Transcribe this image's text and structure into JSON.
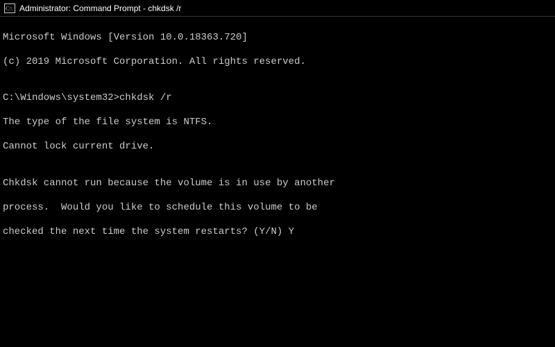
{
  "titlebar": {
    "text": "Administrator: Command Prompt - chkdsk  /r"
  },
  "terminal": {
    "line1": "Microsoft Windows [Version 10.0.18363.720]",
    "line2": "(c) 2019 Microsoft Corporation. All rights reserved.",
    "blank1": "",
    "prompt": "C:\\Windows\\system32>",
    "command": "chkdsk /r",
    "line3": "The type of the file system is NTFS.",
    "line4": "Cannot lock current drive.",
    "blank2": "",
    "line5": "Chkdsk cannot run because the volume is in use by another",
    "line6": "process.  Would you like to schedule this volume to be",
    "line7": "checked the next time the system restarts? (Y/N) Y"
  }
}
